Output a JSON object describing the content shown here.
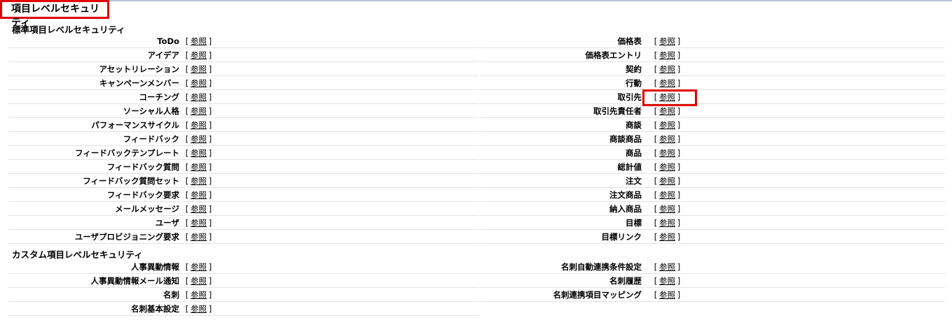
{
  "page": {
    "title": "項目レベルセキュリティ"
  },
  "standard": {
    "title": "標準項目レベルセキュリティ",
    "left": [
      "ToDo",
      "アイデア",
      "アセットリレーション",
      "キャンペーンメンバー",
      "コーチング",
      "ソーシャル人格",
      "パフォーマンスサイクル",
      "フィードバック",
      "フィードバックテンプレート",
      "フィードバック質問",
      "フィードバック質問セット",
      "フィードバック要求",
      "メールメッセージ",
      "ユーザ",
      "ユーザプロビジョニング要求"
    ],
    "right": [
      "価格表",
      "価格表エントリ",
      "契約",
      "行動",
      "取引先",
      "取引先責任者",
      "商談",
      "商談商品",
      "商品",
      "総計値",
      "注文",
      "注文商品",
      "納入商品",
      "目標",
      "目標リンク"
    ]
  },
  "custom": {
    "title": "カスタム項目レベルセキュリティ",
    "left": [
      "人事異動情報",
      "人事異動情報メール通知",
      "名刺",
      "名刺基本設定"
    ],
    "right": [
      "名刺自動連携条件設定",
      "名刺履歴",
      "名刺連携項目マッピング"
    ]
  },
  "common": {
    "view_label": "参照",
    "bracket_open": "[",
    "bracket_close": "]"
  },
  "colors": {
    "highlight": "#e00000",
    "separator": "#e3e3db"
  }
}
